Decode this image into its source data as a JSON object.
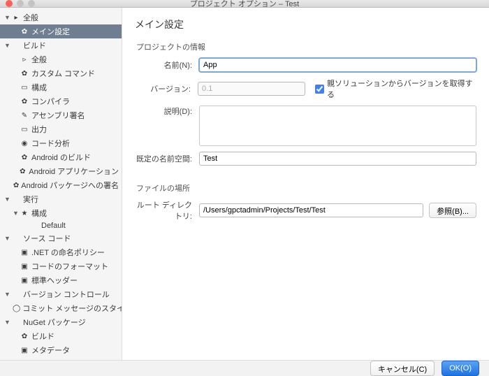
{
  "window": {
    "title": "プロジェクト オプション – Test"
  },
  "sidebar": {
    "items": [
      {
        "label": "全般",
        "depth": 0,
        "icon": "▸",
        "expand": "▼"
      },
      {
        "label": "メイン設定",
        "depth": 1,
        "icon": "✿",
        "selected": true
      },
      {
        "label": "ビルド",
        "depth": 0,
        "icon": "",
        "expand": "▼"
      },
      {
        "label": "全般",
        "depth": 1,
        "icon": "▹"
      },
      {
        "label": "カスタム コマンド",
        "depth": 1,
        "icon": "✿"
      },
      {
        "label": "構成",
        "depth": 1,
        "icon": "▭"
      },
      {
        "label": "コンパイラ",
        "depth": 1,
        "icon": "✿"
      },
      {
        "label": "アセンブリ署名",
        "depth": 1,
        "icon": "✎"
      },
      {
        "label": "出力",
        "depth": 1,
        "icon": "▭"
      },
      {
        "label": "コード分析",
        "depth": 1,
        "icon": "◉"
      },
      {
        "label": "Android のビルド",
        "depth": 1,
        "icon": "✿"
      },
      {
        "label": "Android アプリケーション",
        "depth": 1,
        "icon": "✿"
      },
      {
        "label": "Android パッケージへの署名",
        "depth": 1,
        "icon": "✿"
      },
      {
        "label": "実行",
        "depth": 0,
        "icon": "",
        "expand": "▼"
      },
      {
        "label": "構成",
        "depth": 1,
        "icon": "★",
        "expand": "▼"
      },
      {
        "label": "Default",
        "depth": 2,
        "icon": ""
      },
      {
        "label": "ソース コード",
        "depth": 0,
        "icon": "",
        "expand": "▼"
      },
      {
        "label": ".NET の命名ポリシー",
        "depth": 1,
        "icon": "▣"
      },
      {
        "label": "コードのフォーマット",
        "depth": 1,
        "icon": "▣"
      },
      {
        "label": "標準ヘッダー",
        "depth": 1,
        "icon": "▣"
      },
      {
        "label": "バージョン コントロール",
        "depth": 0,
        "icon": "",
        "expand": "▼"
      },
      {
        "label": "コミット メッセージのスタイル",
        "depth": 1,
        "icon": "◯"
      },
      {
        "label": "NuGet パッケージ",
        "depth": 0,
        "icon": "",
        "expand": "▼"
      },
      {
        "label": "ビルド",
        "depth": 1,
        "icon": "✿"
      },
      {
        "label": "メタデータ",
        "depth": 1,
        "icon": "▣"
      }
    ]
  },
  "content": {
    "heading": "メイン設定",
    "section_info": "プロジェクトの情報",
    "name_label": "名前(N):",
    "name_value": "App",
    "version_label": "バージョン:",
    "version_value": "0.1",
    "version_checkbox_label": "親ソリューションからバージョンを取得する",
    "version_checked": true,
    "desc_label": "説明(D):",
    "desc_value": "",
    "namespace_label": "既定の名前空間:",
    "namespace_value": "Test",
    "section_file": "ファイルの場所",
    "root_label": "ルート ディレクトリ:",
    "root_value": "/Users/gpctadmin/Projects/Test/Test",
    "browse_label": "参照(B)..."
  },
  "footer": {
    "cancel": "キャンセル(C)",
    "ok": "OK(O)"
  }
}
